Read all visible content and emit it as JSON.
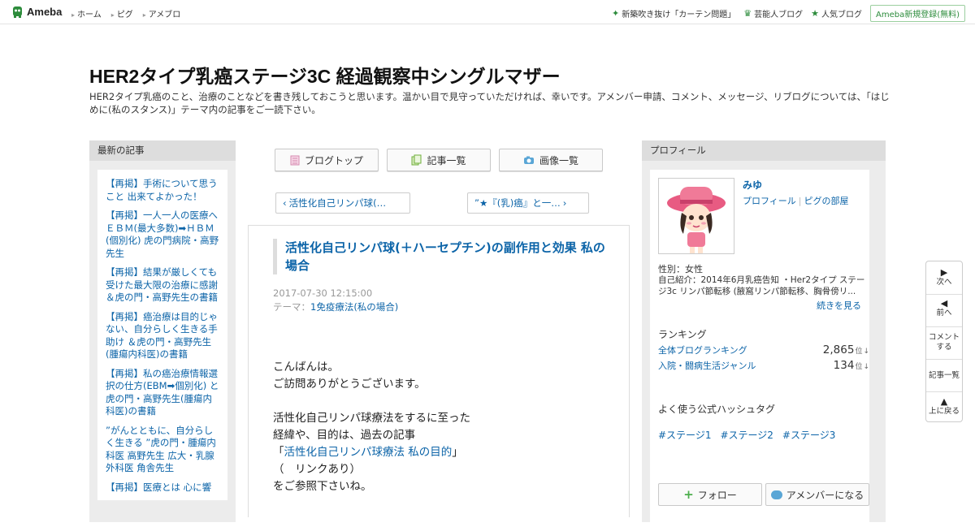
{
  "topbar": {
    "logo_text": "Ameba",
    "nav": [
      "ホーム",
      "ピグ",
      "アメブロ"
    ],
    "right": [
      {
        "icon": "sparkle-icon",
        "label": "新築吹き抜け「カーテン問題」"
      },
      {
        "icon": "crown-icon",
        "label": "芸能人ブログ"
      },
      {
        "icon": "star-icon",
        "label": "人気ブログ"
      }
    ],
    "signup": "Ameba新規登録(無料)",
    "accent": "#2d8c3c"
  },
  "header": {
    "title": "HER2タイプ乳癌ステージ3C 経過観察中シングルマザー",
    "description": "HER2タイプ乳癌のこと、治療のことなどを書き残しておこうと思います。温かい目で見守っていただければ、幸いです。アメンバー申請、コメント、メッセージ、リブログについては、「はじめに(私のスタンス)」テーマ内の記事をご一読下さい。"
  },
  "left": {
    "title": "最新の記事",
    "items": [
      "【再掲】手術について思うこと 出来てよかった！",
      "【再掲】一人一人の医療へ ＥＢＭ(最大多数)➡ＨＢＭ(個別化) 虎の門病院・高野先生",
      "【再掲】結果が厳しくても受けた最大限の治療に感謝 ＆虎の門・高野先生の書籍",
      "【再掲】癌治療は目的じゃない、自分らしく生きる手助け ＆虎の門・高野先生(腫瘍内科医)の書籍",
      "【再掲】私の癌治療情報選択の仕方(EBM➡個別化) と虎の門・高野先生(腫瘍内科医)の書籍",
      "”がんとともに、自分らしく生きる ”虎の門・腫瘍内科医 高野先生 広大・乳腺外科医 角舎先生",
      "【再掲】医療とは 心に響"
    ]
  },
  "center": {
    "tabs": [
      {
        "icon": "blog-top-icon",
        "label": "ブログトップ"
      },
      {
        "icon": "article-list-icon",
        "label": "記事一覧"
      },
      {
        "icon": "camera-icon",
        "label": "画像一覧"
      }
    ],
    "prev": "活性化自己リンパ球(…",
    "next": "”★『(乳)癌』と一…",
    "article": {
      "title": "活性化自己リンパ球(＋ハーセプチン)の副作用と効果 私の場合",
      "date": "2017-07-30 12:15:00",
      "theme_label": "テーマ：",
      "theme": "1免疫療法(私の場合)",
      "body": [
        "こんばんは。",
        "ご訪問ありがとうございます。",
        "",
        "活性化自己リンパ球療法をするに至った",
        "経緯や、目的は、過去の記事"
      ],
      "link_open": "「",
      "link": "活性化自己リンパ球療法 私の目的",
      "link_close": "」",
      "after_link": [
        "（　リンクあり）",
        "をご参照下さいね。"
      ]
    }
  },
  "right": {
    "title": "プロフィール",
    "name": "みゆ",
    "link_profile": "プロフィール",
    "link_pig": "ピグの部屋",
    "gender": "性別：女性",
    "intro": "自己紹介：2014年6月乳癌告知 ・Her2タイプ ステージ3c リンパ節転移 (腋窩リンパ節転移、胸骨傍リ...",
    "more": "続きを見る",
    "ranking_title": "ランキング",
    "rankings": [
      {
        "label": "全体ブログランキング",
        "value": "2,865",
        "unit": "位",
        "trend": "↓"
      },
      {
        "label": "入院・闘病生活ジャンル",
        "value": "134",
        "unit": "位",
        "trend": "↓"
      }
    ],
    "hashtag_title": "よく使う公式ハッシュタグ",
    "hashtags": [
      "#ステージ1",
      "#ステージ2",
      "#ステージ3"
    ],
    "follow": "フォロー",
    "amember": "アメンバーになる"
  },
  "floatnav": {
    "next": "次へ",
    "prev": "前へ",
    "comment_l1": "コメント",
    "comment_l2": "する",
    "list": "記事一覧",
    "top": "上に戻る"
  }
}
